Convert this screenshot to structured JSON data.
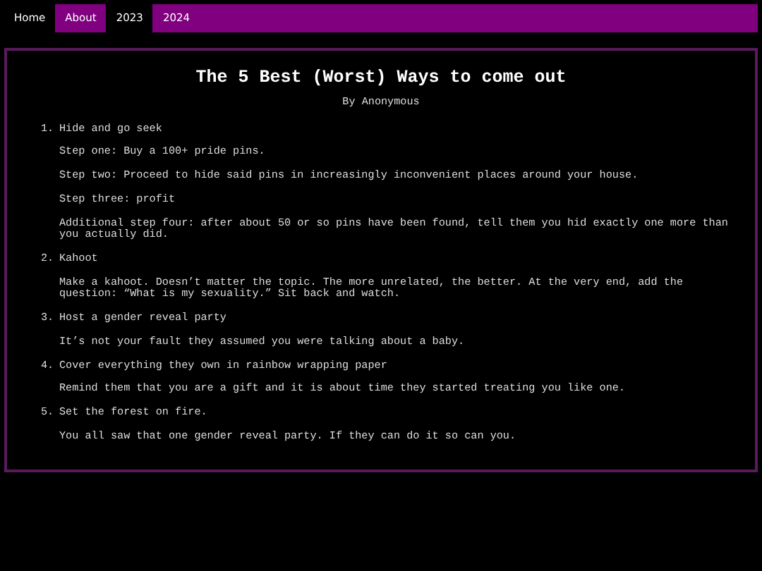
{
  "nav": [
    {
      "label": "Home",
      "highlighted": false
    },
    {
      "label": "About",
      "highlighted": true
    },
    {
      "label": "2023",
      "highlighted": false
    },
    {
      "label": "2024",
      "highlighted": true
    }
  ],
  "article": {
    "title": "The 5 Best (Worst) Ways to come out",
    "byline": "By Anonymous",
    "items": [
      {
        "number": "1.",
        "heading": "Hide and go seek",
        "paragraphs": [
          "Step one: Buy a 100+ pride pins.",
          "Step two: Proceed to hide said pins in increasingly inconvenient places around your house.",
          "Step three: profit",
          "Additional step four: after about 50 or so pins have been found, tell them you hid exactly one more than you actually did."
        ]
      },
      {
        "number": "2.",
        "heading": "Kahoot",
        "paragraphs": [
          "Make a kahoot. Doesn’t matter the topic. The more unrelated, the better. At the very end, add the question: “What is my sexuality.” Sit back and watch."
        ]
      },
      {
        "number": "3.",
        "heading": "Host a gender reveal party",
        "paragraphs": [
          "It’s not your fault they assumed you were talking about a baby."
        ]
      },
      {
        "number": "4.",
        "heading": "Cover everything they own in rainbow wrapping paper",
        "paragraphs": [
          "Remind them that you are a gift and it is about time they started treating you like one."
        ]
      },
      {
        "number": "5.",
        "heading": "Set the forest on fire.",
        "paragraphs": [
          "You all saw that one gender reveal party. If they can do it so can you."
        ]
      }
    ]
  }
}
